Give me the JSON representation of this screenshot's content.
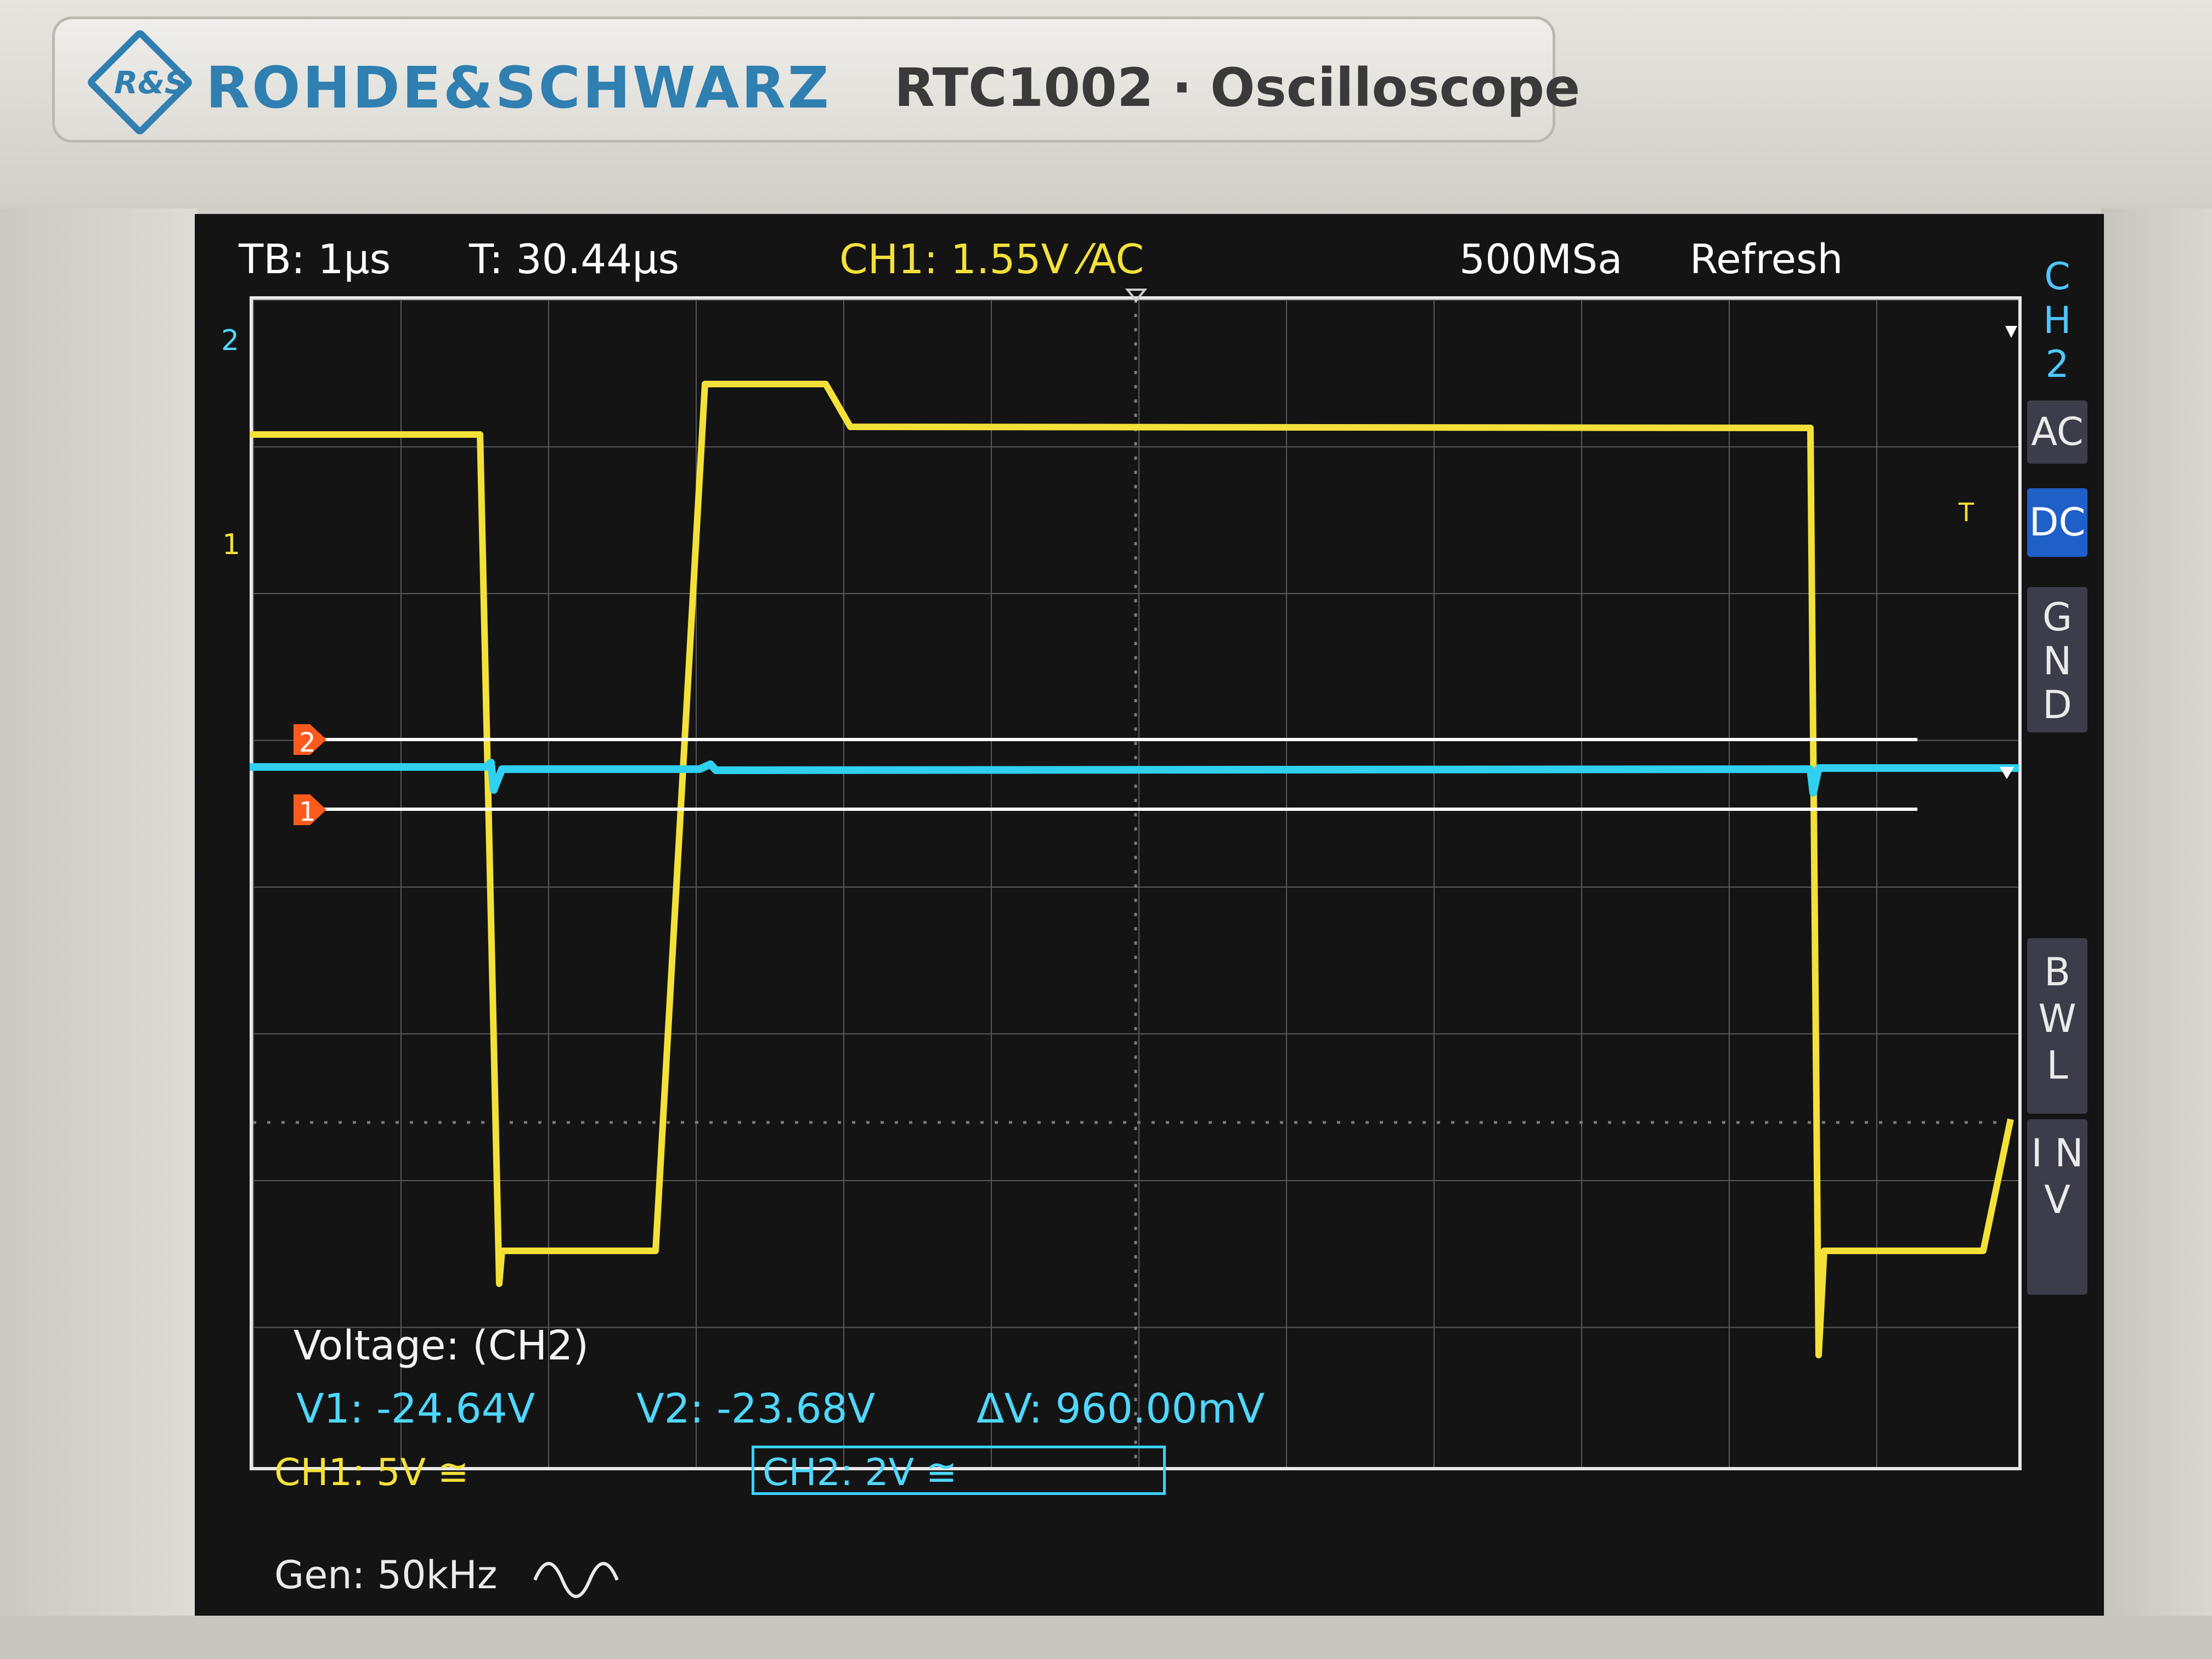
{
  "brand": {
    "logo_text": "R&S",
    "name": "ROHDE&SCHWARZ",
    "model": "RTC1002",
    "separator": "·",
    "product": "Oscilloscope"
  },
  "status": {
    "timebase": "TB: 1µs",
    "trigger_time": "T: 30.44µs",
    "trigger": "CH1: 1.55V ⁄AC",
    "sample_rate": "500MSa",
    "mode": "Refresh"
  },
  "side_menu": {
    "channel": "C H 2",
    "ac": "AC",
    "dc": "DC",
    "gnd": "G N D",
    "bwl": "B W L",
    "inv": "I N V"
  },
  "markers": {
    "ch1": "1",
    "ch2": "2",
    "trigger": "T"
  },
  "measurement": {
    "title": "Voltage: (CH2)",
    "v1": "V1: -24.64V",
    "v2": "V2: -23.68V",
    "delta": "ΔV: 960.00mV"
  },
  "scales": {
    "ch1": "CH1: 5V ≅",
    "ch2": "CH2: 2V ≅"
  },
  "generator": {
    "label": "Gen:",
    "frequency": "50kHz"
  },
  "colors": {
    "ch1": "#f3e13a",
    "ch2": "#2fd0f0",
    "cursor": "#ffffff",
    "marker": "#ff5a1e",
    "active_tab": "#1f5fc8"
  }
}
